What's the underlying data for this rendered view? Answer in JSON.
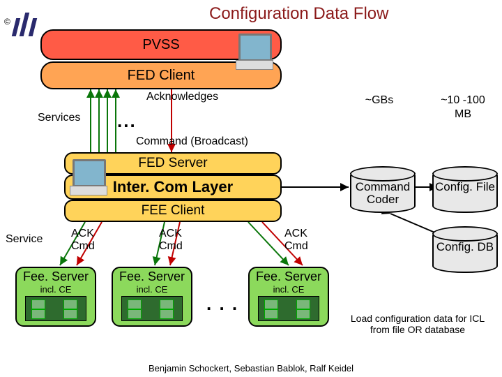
{
  "title": "Configuration Data Flow",
  "copyright": "©",
  "pvss": "PVSS",
  "fed_client": "FED Client",
  "acknowledges": "Acknowledges",
  "services": "Services",
  "command_broadcast": "Command (Broadcast)",
  "fed_server": "FED Server",
  "intercom": "Inter. Com Layer",
  "fee_client": "FEE Client",
  "service_label": "Service",
  "ack": "ACK",
  "cmd": "Cmd",
  "fee_server": "Fee. Server",
  "incl_ce": "incl. CE",
  "note_gbs": "~GBs",
  "note_mb": "~10 -100 MB",
  "command_coder": "Command Coder",
  "config_file": "Config. File",
  "config_db": "Config. DB",
  "caption": "Load configuration data for ICL from file OR database",
  "footer": "Benjamin Schockert, Sebastian Bablok, Ralf Keidel",
  "ellipsis": ". . ."
}
